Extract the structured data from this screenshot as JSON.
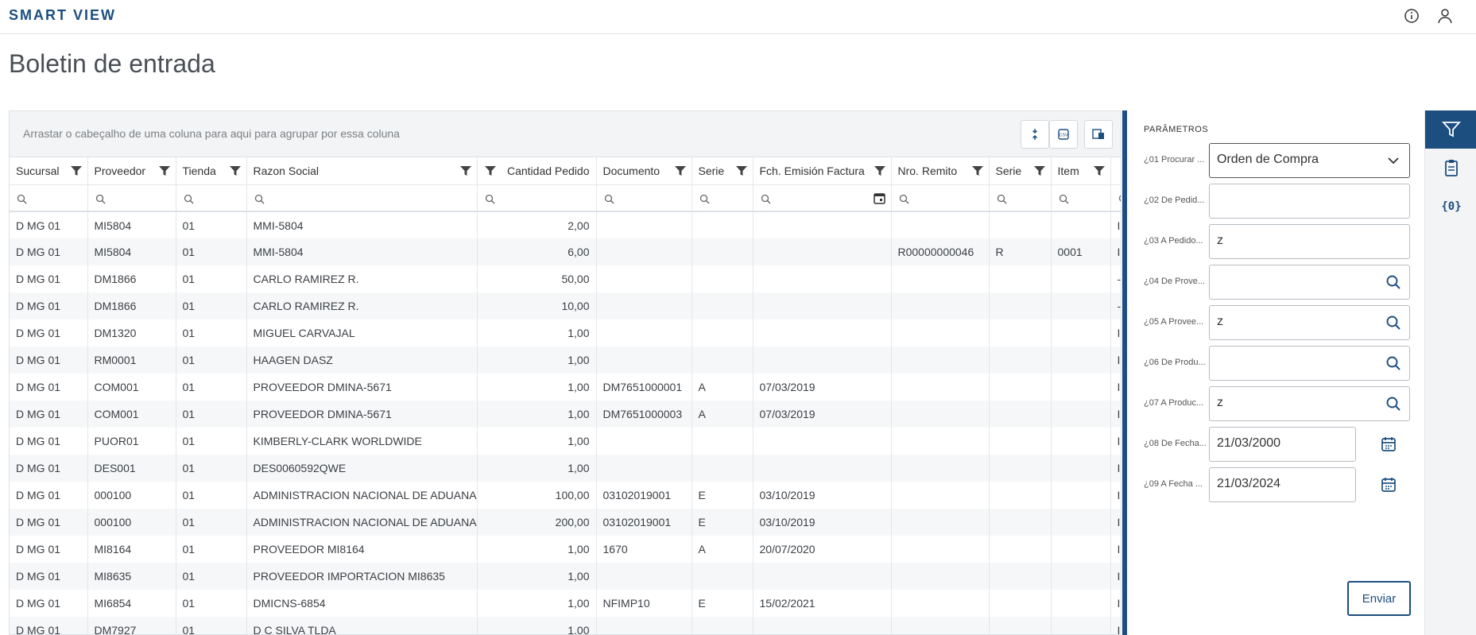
{
  "app": {
    "brand": "SMART VIEW"
  },
  "page": {
    "title": "Boletin de entrada"
  },
  "grid": {
    "group_hint": "Arrastar o cabeçalho de uma coluna para aqui para agrupar por essa coluna",
    "columns": [
      "Sucursal",
      "Proveedor",
      "Tienda",
      "Razon Social",
      "Cantidad Pedido",
      "Documento",
      "Serie",
      "Fch. Emisión Factura",
      "Nro. Remito",
      "Serie",
      "Item",
      ""
    ],
    "rows": [
      [
        "D MG 01",
        "MI5804",
        "01",
        "MMI-5804",
        "2,00",
        "",
        "",
        "",
        "",
        "",
        "",
        "I"
      ],
      [
        "D MG 01",
        "MI5804",
        "01",
        "MMI-5804",
        "6,00",
        "",
        "",
        "",
        "R00000000046",
        "R",
        "0001",
        "I"
      ],
      [
        "D MG 01",
        "DM1866",
        "01",
        "CARLO RAMIREZ R.",
        "50,00",
        "",
        "",
        "",
        "",
        "",
        "",
        "-"
      ],
      [
        "D MG 01",
        "DM1866",
        "01",
        "CARLO RAMIREZ R.",
        "10,00",
        "",
        "",
        "",
        "",
        "",
        "",
        "-"
      ],
      [
        "D MG 01",
        "DM1320",
        "01",
        "MIGUEL CARVAJAL",
        "1,00",
        "",
        "",
        "",
        "",
        "",
        "",
        "I"
      ],
      [
        "D MG 01",
        "RM0001",
        "01",
        "HAAGEN DASZ",
        "1,00",
        "",
        "",
        "",
        "",
        "",
        "",
        "I"
      ],
      [
        "D MG 01",
        "COM001",
        "01",
        "PROVEEDOR DMINA-5671",
        "1,00",
        "DM7651000001",
        "A",
        "07/03/2019",
        "",
        "",
        "",
        "I"
      ],
      [
        "D MG 01",
        "COM001",
        "01",
        "PROVEEDOR DMINA-5671",
        "1,00",
        "DM7651000003",
        "A",
        "07/03/2019",
        "",
        "",
        "",
        "I"
      ],
      [
        "D MG 01",
        "PUOR01",
        "01",
        "KIMBERLY-CLARK WORLDWIDE",
        "1,00",
        "",
        "",
        "",
        "",
        "",
        "",
        "I"
      ],
      [
        "D MG 01",
        "DES001",
        "01",
        "DES0060592QWE",
        "1,00",
        "",
        "",
        "",
        "",
        "",
        "",
        "I"
      ],
      [
        "D MG 01",
        "000100",
        "01",
        "ADMINISTRACION NACIONAL DE ADUANAS",
        "100,00",
        "03102019001",
        "E",
        "03/10/2019",
        "",
        "",
        "",
        "I"
      ],
      [
        "D MG 01",
        "000100",
        "01",
        "ADMINISTRACION NACIONAL DE ADUANAS",
        "200,00",
        "03102019001",
        "E",
        "03/10/2019",
        "",
        "",
        "",
        "I"
      ],
      [
        "D MG 01",
        "MI8164",
        "01",
        "PROVEEDOR MI8164",
        "1,00",
        "1670",
        "A",
        "20/07/2020",
        "",
        "",
        "",
        "I"
      ],
      [
        "D MG 01",
        "MI8635",
        "01",
        "PROVEEDOR IMPORTACION MI8635",
        "1,00",
        "",
        "",
        "",
        "",
        "",
        "",
        "I"
      ],
      [
        "D MG 01",
        "MI6854",
        "01",
        "DMICNS-6854",
        "1,00",
        "NFIMP10",
        "E",
        "15/02/2021",
        "",
        "",
        "",
        "I"
      ],
      [
        "D MG 01",
        "DM7927",
        "01",
        "D C SILVA TLDA",
        "1,00",
        "",
        "",
        "",
        "",
        "",
        "",
        "I"
      ]
    ]
  },
  "params": {
    "title": "PARÂMETROS",
    "fields": [
      {
        "label": "¿01 Procurar ...",
        "value": "Orden de Compra",
        "type": "select"
      },
      {
        "label": "¿02 De Pedid...",
        "value": "",
        "type": "text"
      },
      {
        "label": "¿03 A Pedido...",
        "value": "z",
        "type": "text"
      },
      {
        "label": "¿04 De Prove...",
        "value": "",
        "type": "lookup"
      },
      {
        "label": "¿05 A Provee...",
        "value": "z",
        "type": "lookup"
      },
      {
        "label": "¿06 De Produ...",
        "value": "",
        "type": "lookup"
      },
      {
        "label": "¿07 A Produc...",
        "value": "z",
        "type": "lookup"
      },
      {
        "label": "¿08 De Fecha...",
        "value": "21/03/2000",
        "type": "date"
      },
      {
        "label": "¿09 A Fecha ...",
        "value": "21/03/2024",
        "type": "date"
      }
    ],
    "send_label": "Enviar"
  },
  "colors": {
    "primary": "#1c4e80",
    "border": "#dde1e5"
  },
  "icons": [
    "info-icon",
    "user-icon",
    "filter-icon",
    "search-icon",
    "calendar-icon",
    "chevron-down-icon",
    "clipboard-icon",
    "variables-icon"
  ]
}
